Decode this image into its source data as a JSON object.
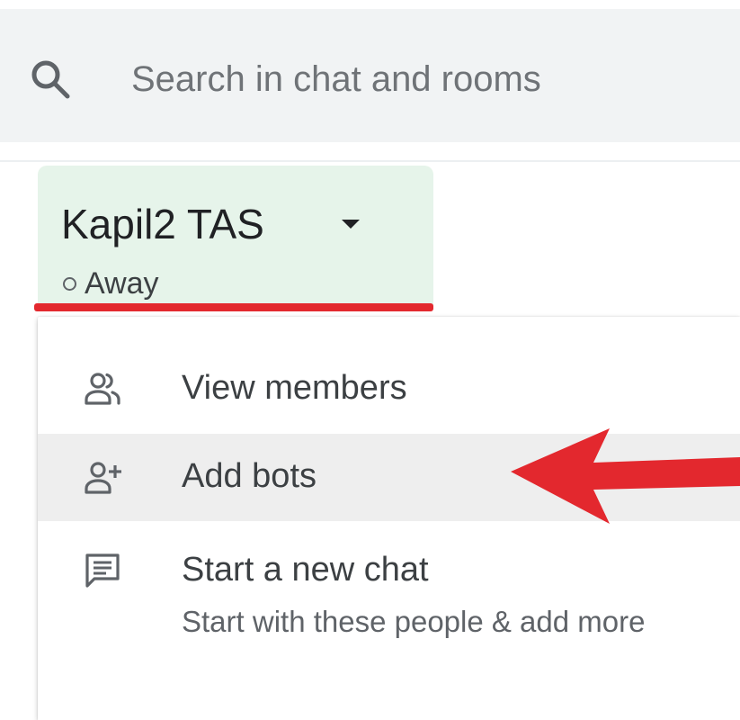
{
  "search": {
    "placeholder": "Search in chat and rooms"
  },
  "room": {
    "name": "Kapil2 TAS",
    "status": "Away"
  },
  "menu": {
    "items": [
      {
        "label": "View members",
        "icon": "people-icon"
      },
      {
        "label": "Add bots",
        "icon": "person-add-icon",
        "highlighted": true
      },
      {
        "label": "Start a new chat",
        "sublabel": "Start with these people & add more",
        "icon": "chat-icon"
      }
    ]
  },
  "colors": {
    "search_bg": "#f1f3f4",
    "room_header_bg": "#e6f4ea",
    "highlight_bg": "#eeeeee",
    "annotation_red": "#e3282e",
    "text_primary": "#202124",
    "text_secondary": "#5f6368"
  }
}
